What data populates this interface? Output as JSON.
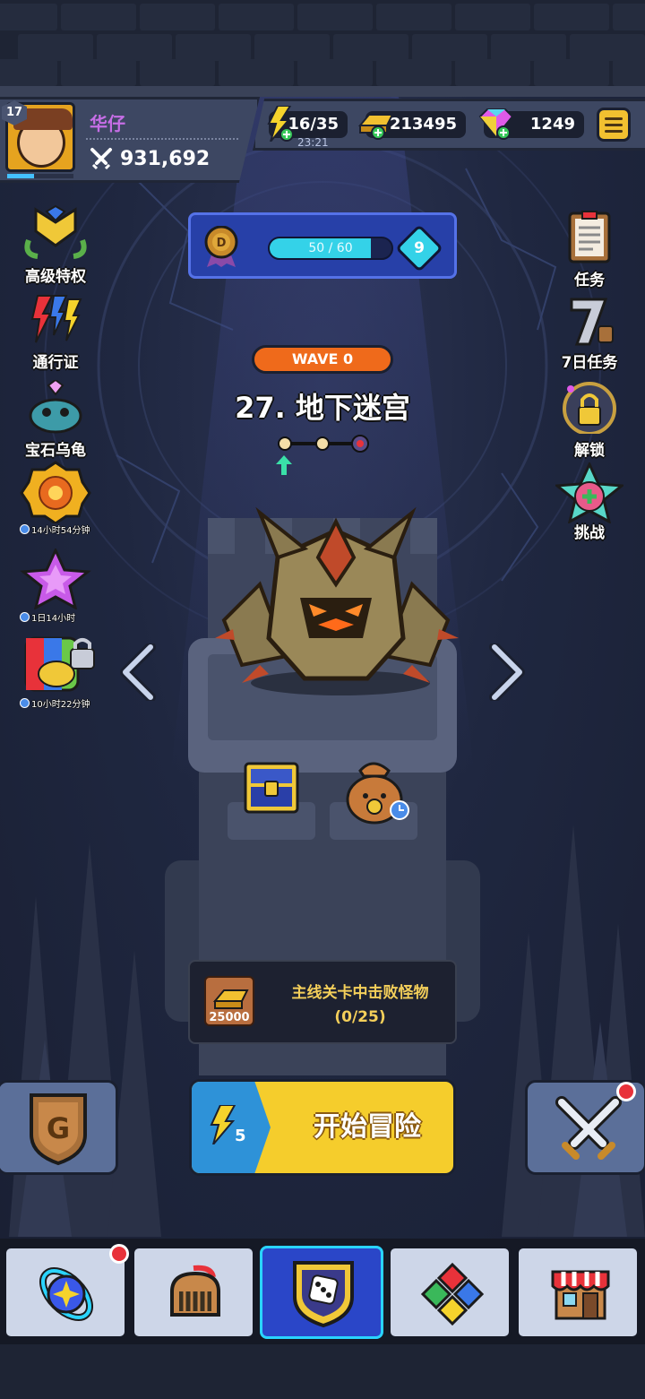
{
  "player": {
    "level": "17",
    "name": "华仔",
    "power": "931,692"
  },
  "resources": {
    "energy": "16/35",
    "energy_timer": "23:21",
    "gold": "213495",
    "gems": "1249"
  },
  "left_menu": [
    {
      "label": "高级特权",
      "icon": "vip-chevron-icon"
    },
    {
      "label": "通行证",
      "icon": "pass-lightning-icon"
    },
    {
      "label": "宝石乌龟",
      "icon": "gem-turtle-icon"
    },
    {
      "label": "",
      "icon": "event-medal-icon",
      "timer": "14小时54分钟"
    },
    {
      "label": "",
      "icon": "purple-star-icon",
      "timer": "1日14小时"
    },
    {
      "label": "",
      "icon": "rainbow-pack-icon",
      "timer": "10小时22分钟"
    }
  ],
  "right_menu": [
    {
      "label": "任务",
      "icon": "clipboard-icon"
    },
    {
      "label": "7日任务",
      "icon": "seven-day-icon"
    },
    {
      "label": "解锁",
      "icon": "lock-icon"
    },
    {
      "label": "挑战",
      "icon": "challenge-star-icon"
    }
  ],
  "stage_progress": {
    "label": "50 / 60",
    "fraction": 0.83,
    "level": "9"
  },
  "wave": "WAVE 0",
  "stage_title": "27. 地下迷宫",
  "quest": {
    "reward": "25000",
    "line1": "主线关卡中击败怪物",
    "line2": "(0/25)"
  },
  "start_button": {
    "cost": "5",
    "label": "开始冒险"
  },
  "nav": [
    {
      "name": "nav-talent",
      "icon": "talent-orb-icon"
    },
    {
      "name": "nav-hero",
      "icon": "knight-helmet-icon"
    },
    {
      "name": "nav-battle",
      "icon": "dice-shield-icon"
    },
    {
      "name": "nav-gems",
      "icon": "gem-arrows-icon"
    },
    {
      "name": "nav-shop",
      "icon": "shop-icon"
    }
  ]
}
